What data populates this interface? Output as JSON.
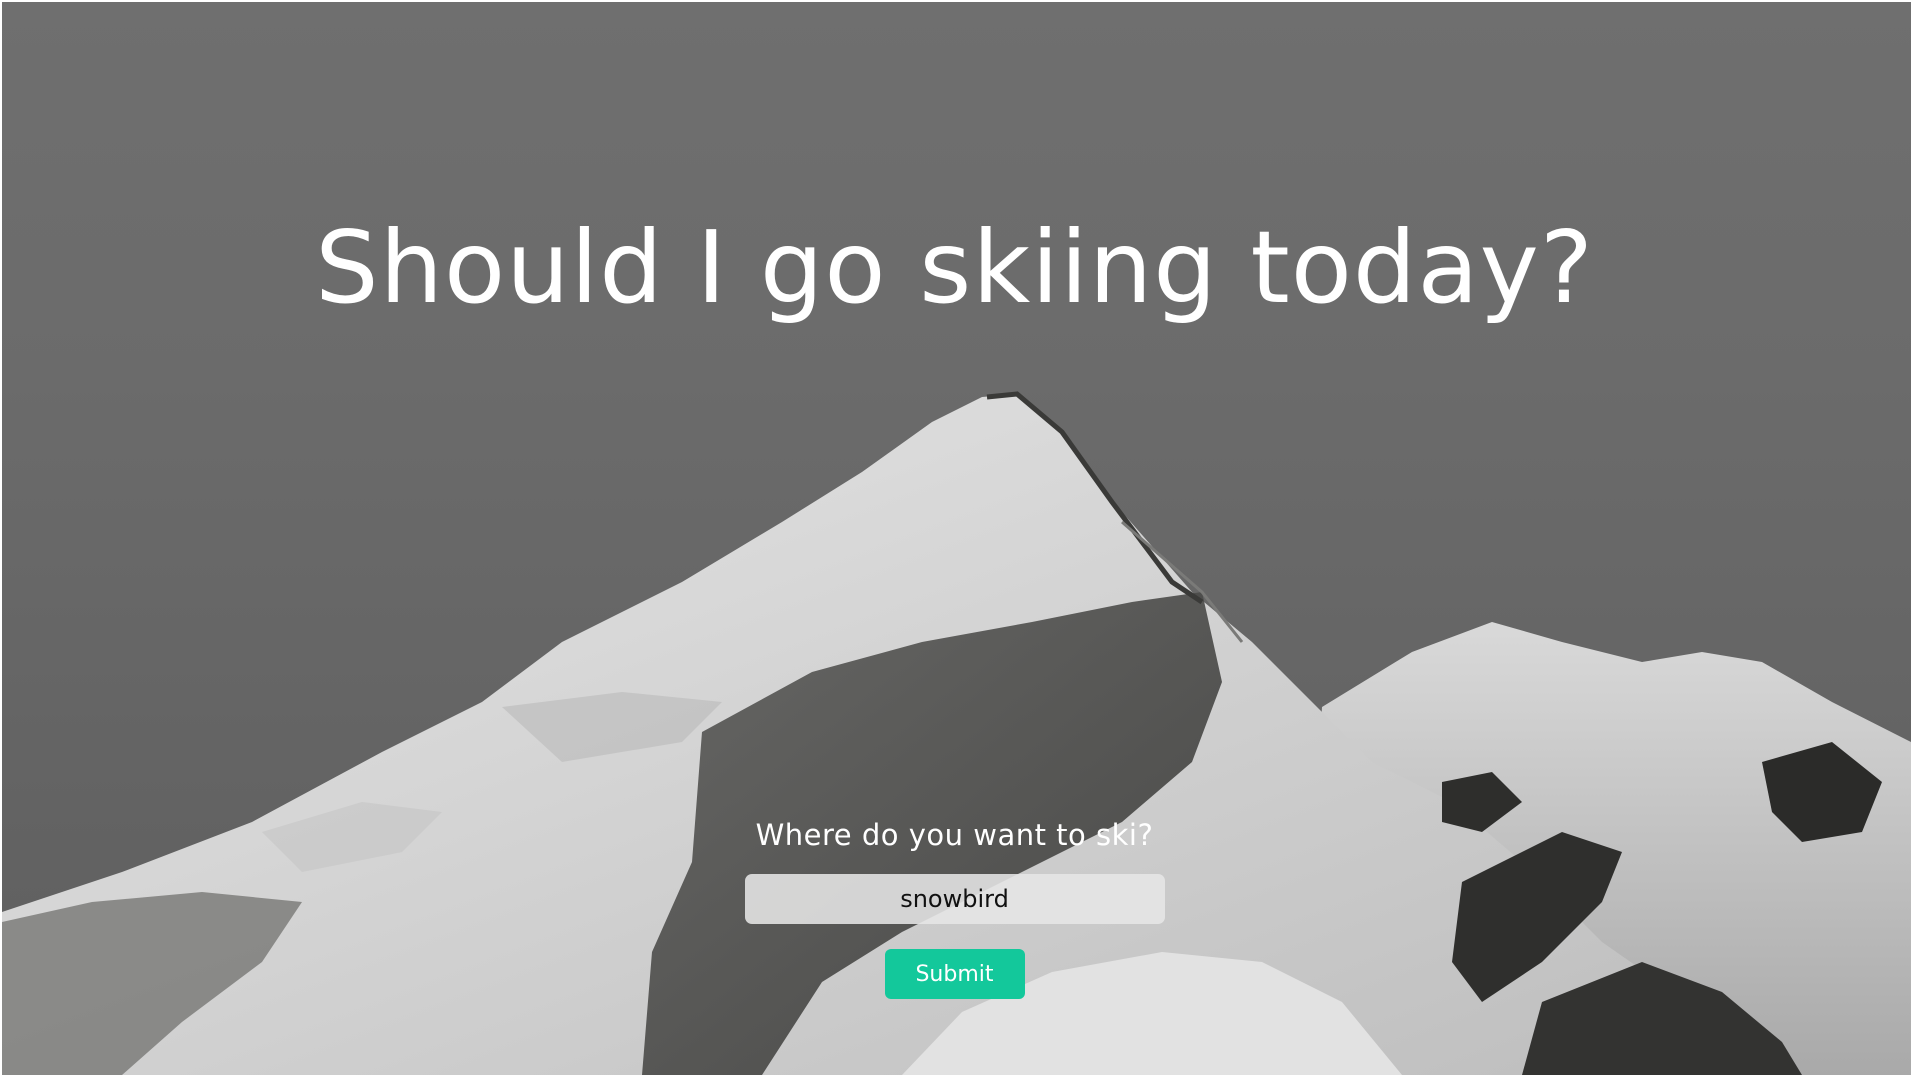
{
  "page": {
    "heading": "Should I go skiing today?"
  },
  "form": {
    "prompt": "Where do you want to ski?",
    "location_value": "snowbird",
    "submit_label": "Submit"
  },
  "colors": {
    "submit_button": "#13c89b",
    "text": "#ffffff"
  }
}
